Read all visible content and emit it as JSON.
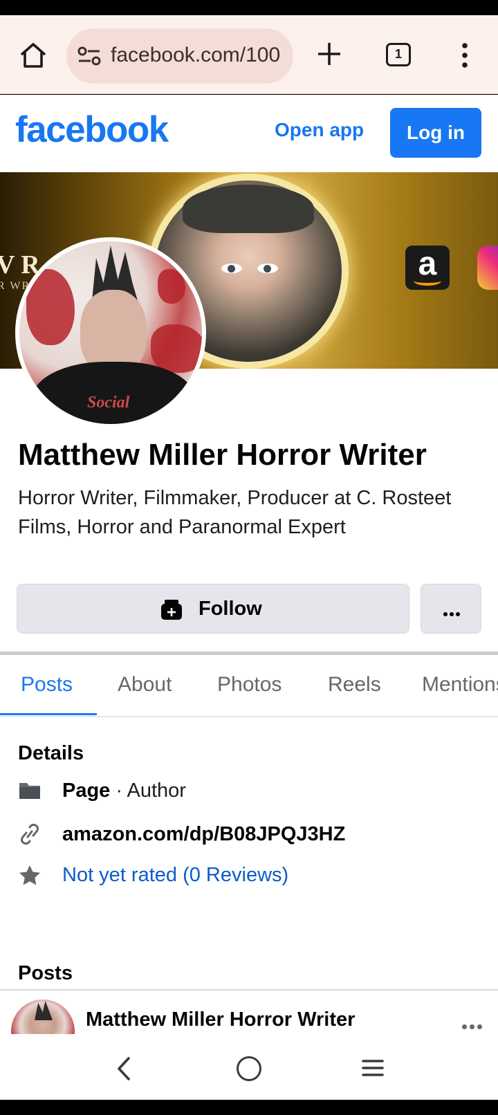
{
  "browser": {
    "url": "facebook.com/100",
    "tab_count": "1"
  },
  "header": {
    "logo": "facebook",
    "open_app": "Open app",
    "login": "Log in"
  },
  "cover": {
    "text_line1": "V R. M",
    "text_line2": "R WRI"
  },
  "avatar": {
    "shirt_text": "Social"
  },
  "profile": {
    "name": "Matthew Miller Horror Writer",
    "bio": "Horror Writer, Filmmaker, Producer at C. Rosteet Films, Horror and Paranormal Expert"
  },
  "actions": {
    "follow": "Follow"
  },
  "tabs": [
    "Posts",
    "About",
    "Photos",
    "Reels",
    "Mentions"
  ],
  "details": {
    "title": "Details",
    "page_label": "Page",
    "page_category": " · Author",
    "website": "amazon.com/dp/B08JPQJ3HZ",
    "rating": "Not yet rated (0 Reviews)"
  },
  "posts": {
    "title": "Posts",
    "author": "Matthew Miller Horror Writer"
  },
  "colors": {
    "brand": "#1877f2",
    "link": "#0a5cc7",
    "button_bg": "#e4e6eb"
  }
}
